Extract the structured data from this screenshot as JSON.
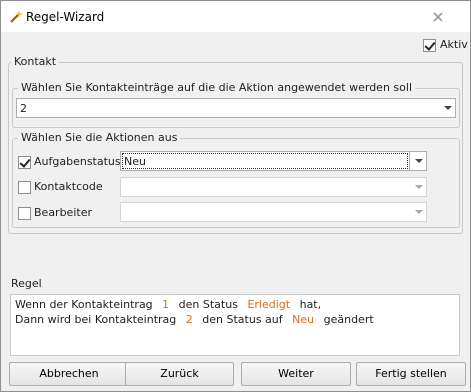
{
  "window": {
    "title": "Regel-Wizard"
  },
  "activ": {
    "label": "Aktiv",
    "checked": true
  },
  "contact_group": {
    "title": "Kontakt",
    "select_group": {
      "title": "Wählen Sie Kontakteinträge auf die die Aktion angewendet werden soll",
      "value": "2"
    },
    "actions_group": {
      "title": "Wählen Sie die Aktionen aus",
      "rows": [
        {
          "label": "Aufgabenstatus",
          "checked": true,
          "value": "Neu",
          "enabled": true
        },
        {
          "label": "Kontaktcode",
          "checked": false,
          "value": "",
          "enabled": false
        },
        {
          "label": "Bearbeiter",
          "checked": false,
          "value": "",
          "enabled": false
        }
      ]
    }
  },
  "rule": {
    "title": "Regel",
    "line1": {
      "a": "Wenn der Kontakteintrag",
      "b": "1",
      "c": "den Status",
      "d": "Erledigt",
      "e": "hat,"
    },
    "line2": {
      "a": "Dann wird bei Kontakteintrag",
      "b": "2",
      "c": "den Status auf",
      "d": "Neu",
      "e": "geändert"
    }
  },
  "buttons": {
    "cancel": "Abbrechen",
    "back": "Zurück",
    "next": "Weiter",
    "finish": "Fertig stellen"
  },
  "colors": {
    "highlight": "#d86c1f",
    "window_bg": "#f0f0f0"
  },
  "icons": {
    "title_icon": "magic-wand-icon",
    "close_icon": "close-icon"
  }
}
